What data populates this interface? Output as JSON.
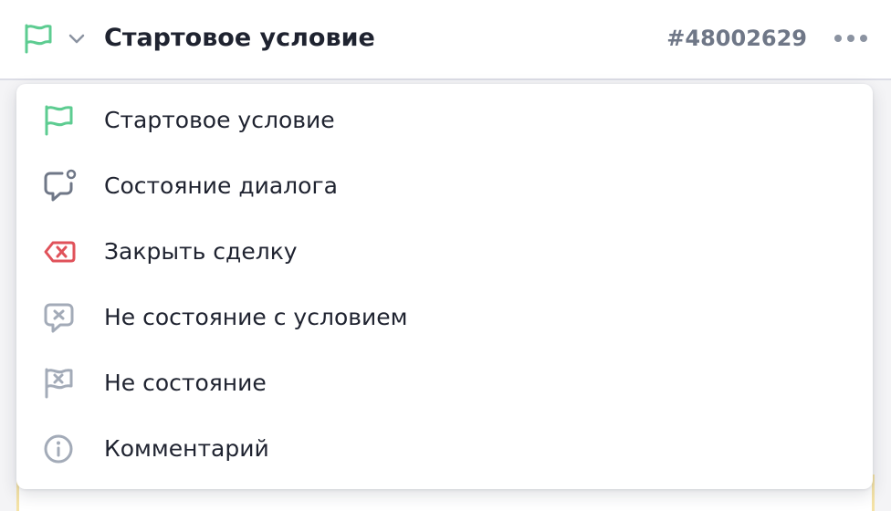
{
  "header": {
    "title": "Стартовое условие",
    "node_id": "#48002629",
    "flag_icon": "flag-icon",
    "dropdown_icon": "chevron-down-icon",
    "more_icon": "more-horizontal-icon"
  },
  "menu": {
    "items": [
      {
        "label": "Стартовое условие",
        "icon": "flag-icon",
        "color": "#5dcc91"
      },
      {
        "label": "Состояние диалога",
        "icon": "chat-bubble-dot-icon",
        "color": "#6f7787"
      },
      {
        "label": "Закрыть сделку",
        "icon": "close-tag-icon",
        "color": "#e0525a"
      },
      {
        "label": "Не состояние с условием",
        "icon": "chat-bubble-x-icon",
        "color": "#a3abb8"
      },
      {
        "label": "Не состояние",
        "icon": "flag-x-icon",
        "color": "#a3abb8"
      },
      {
        "label": "Комментарий",
        "icon": "info-circle-icon",
        "color": "#a3abb8"
      }
    ]
  },
  "colors": {
    "accent_green": "#5dcc91",
    "danger_red": "#e0525a",
    "muted_gray": "#a3abb8",
    "text_dark": "#1f2330",
    "id_gray": "#6f7787"
  }
}
